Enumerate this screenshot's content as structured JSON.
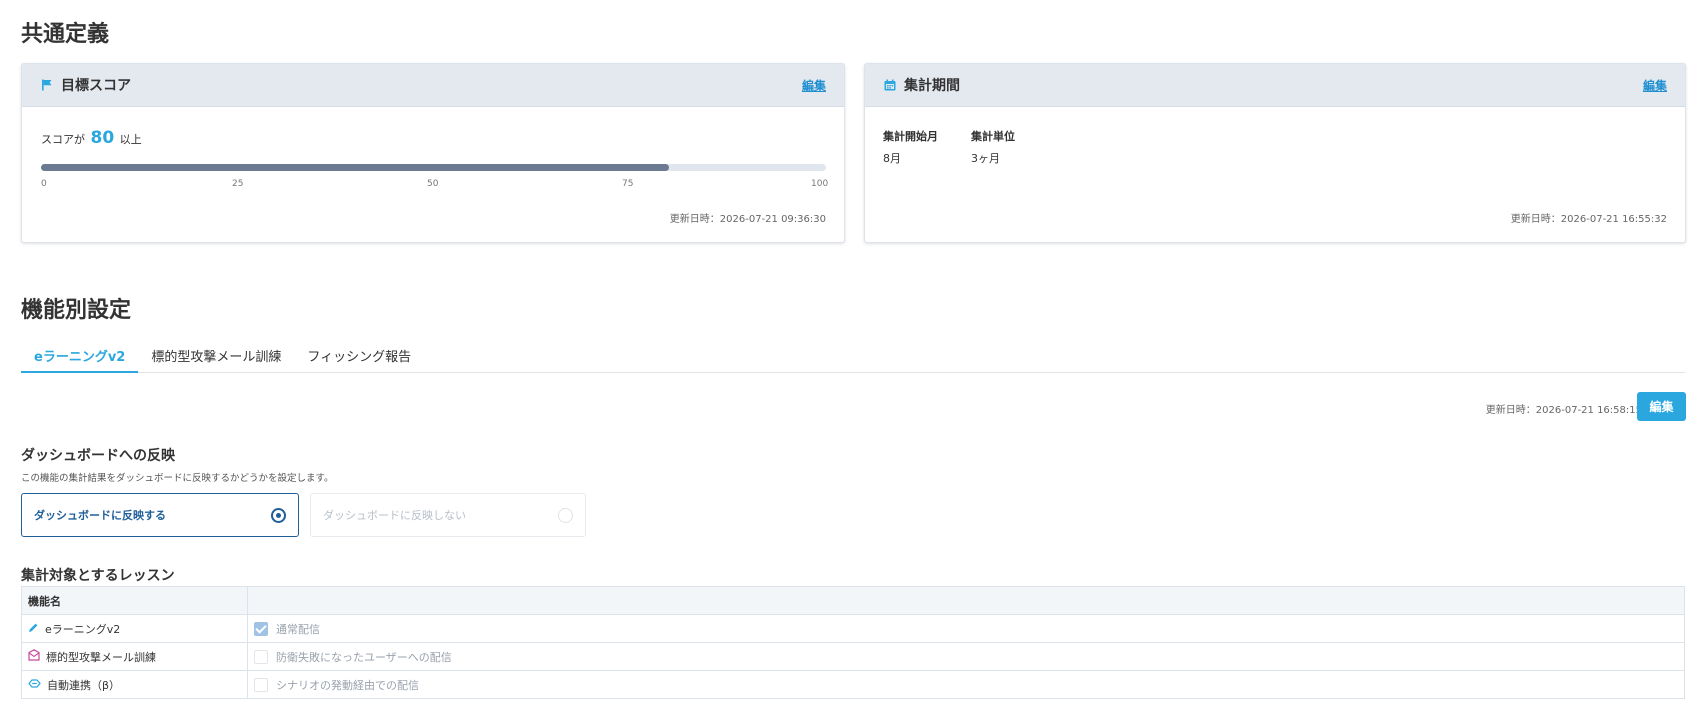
{
  "common": {
    "title": "共通定義",
    "target_score": {
      "title": "目標スコア",
      "edit": "編集",
      "prefix": "スコアが",
      "score": "80",
      "suffix": "以上",
      "progress_fraction": 0.8,
      "ticks": [
        "0",
        "25",
        "50",
        "75",
        "100"
      ],
      "updated": "更新日時：2026-07-21 09:36:30"
    },
    "period": {
      "title": "集計期間",
      "edit": "編集",
      "start_label": "集計開始月",
      "start_value": "8月",
      "unit_label": "集計単位",
      "unit_value": "3ヶ月",
      "updated": "更新日時：2026-07-21 16:55:32"
    }
  },
  "feature": {
    "title": "機能別設定",
    "tabs": [
      "eラーニングv2",
      "標的型攻撃メール訓練",
      "フィッシング報告"
    ],
    "updated": "更新日時：2026-07-21 16:58:15",
    "edit": "編集",
    "dashboard": {
      "title": "ダッシュボードへの反映",
      "desc": "この機能の集計結果をダッシュボードに反映するかどうかを設定します。",
      "option_on": "ダッシュボードに反映する",
      "option_off": "ダッシュボードに反映しない"
    },
    "lessons": {
      "title": "集計対象とするレッスン",
      "header": "機能名",
      "rows": [
        {
          "name": "eラーニングv2",
          "option": "通常配信",
          "checked": true
        },
        {
          "name": "標的型攻撃メール訓練",
          "option": "防衛失敗になったユーザーへの配信",
          "checked": false
        },
        {
          "name": "自動連携（β）",
          "option": "シナリオの発動経由での配信",
          "checked": false
        }
      ]
    }
  },
  "colors": {
    "accent": "#2aa7de",
    "header_bg": "#e4e9f0",
    "progress_fill": "#6b7a91",
    "selected_border": "#1f5f99"
  }
}
